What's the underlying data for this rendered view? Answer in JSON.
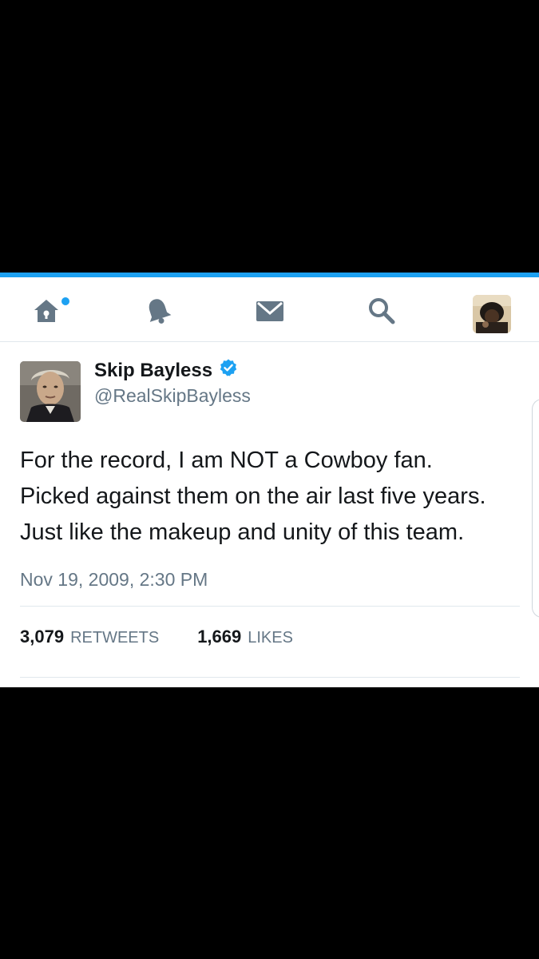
{
  "nav": {
    "items": [
      {
        "icon": "home-icon"
      },
      {
        "icon": "bell-icon"
      },
      {
        "icon": "mail-icon"
      },
      {
        "icon": "search-icon"
      },
      {
        "icon": "profile-avatar"
      }
    ],
    "accent_color": "#1da1f2"
  },
  "tweet": {
    "author_name": "Skip Bayless",
    "author_handle": "@RealSkipBayless",
    "verified": true,
    "text_lines": [
      "For the record, I am NOT a Cowboy fan.",
      "Picked against them on the air last five years.",
      "Just like the makeup and unity of this team."
    ],
    "timestamp": "Nov 19, 2009, 2:30 PM",
    "retweets_count": "3,079",
    "retweets_label": "RETWEETS",
    "likes_count": "1,669",
    "likes_label": "LIKES"
  },
  "colors": {
    "text_primary": "#14171a",
    "text_secondary": "#657786",
    "brand_blue": "#1da1f2",
    "icon_gray": "#657786"
  }
}
